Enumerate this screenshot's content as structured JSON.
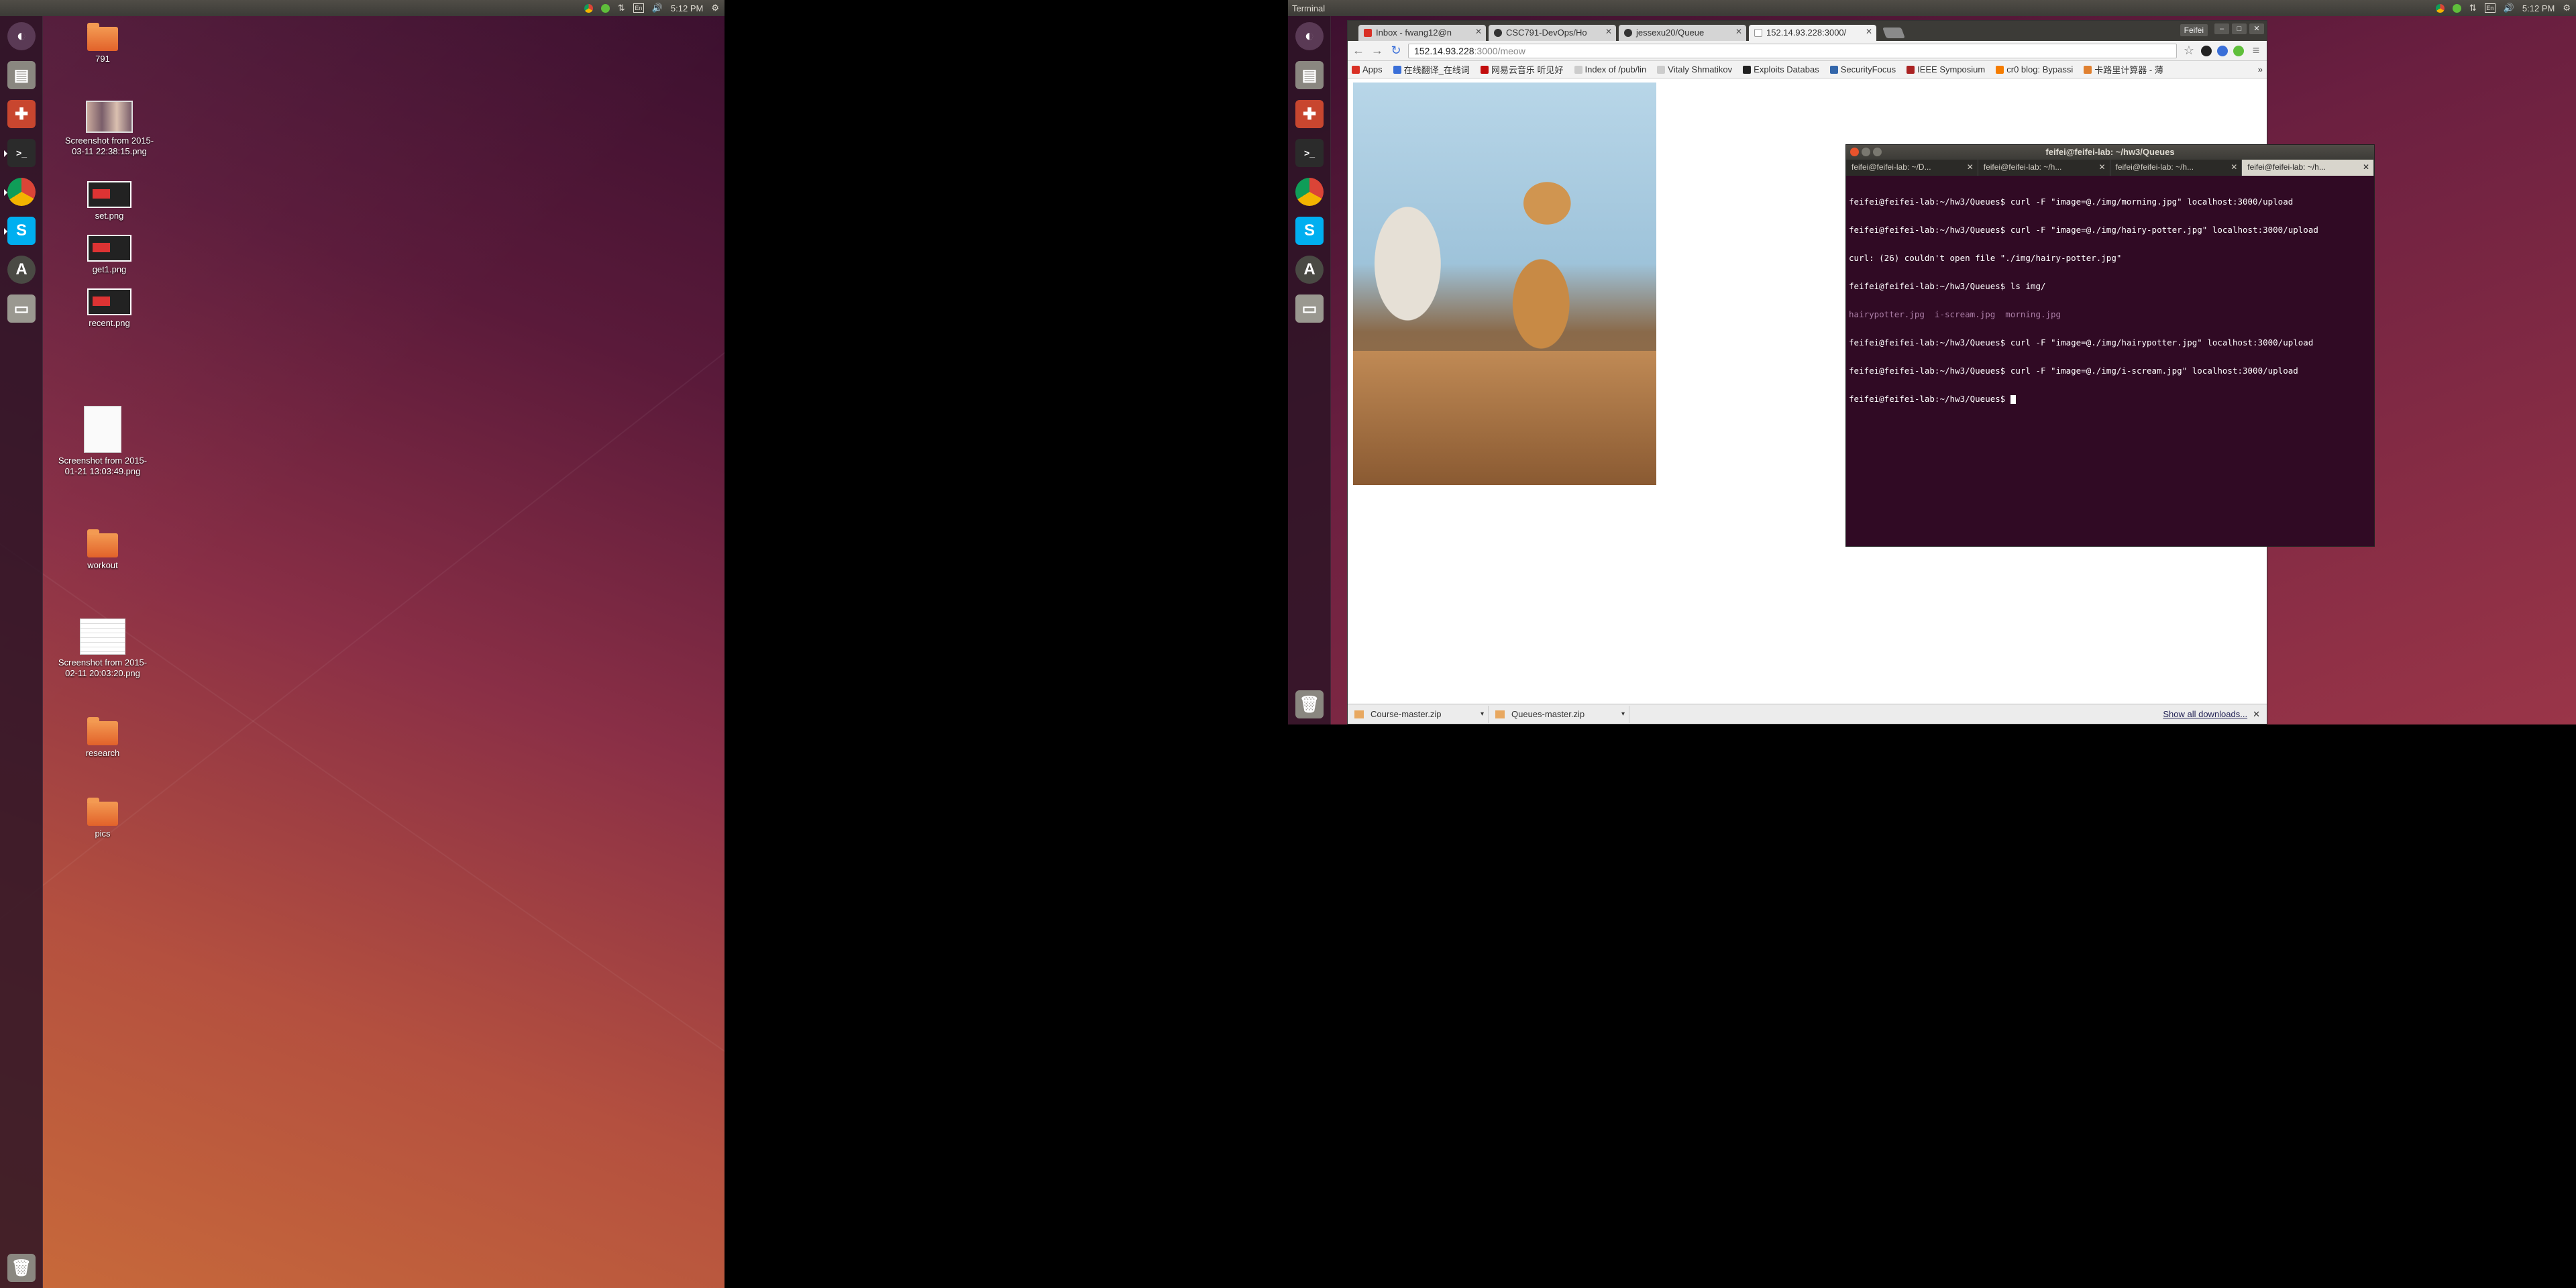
{
  "left_screen": {
    "panel": {
      "time": "5:12 PM",
      "keyboard": "En"
    },
    "launcher": [
      "dash-home",
      "files",
      "system-settings",
      "terminal",
      "chrome",
      "skype",
      "software-updater",
      "removable-drive",
      "trash"
    ],
    "desktop_icons": [
      {
        "type": "folder",
        "label": "791"
      },
      {
        "type": "photo",
        "label": "Screenshot from 2015-03-11 22:38:15.png"
      },
      {
        "type": "dark",
        "label": "set.png"
      },
      {
        "type": "dark",
        "label": "get1.png"
      },
      {
        "type": "dark",
        "label": "recent.png"
      },
      {
        "type": "doc",
        "label": "Screenshot from 2015-01-21 13:03:49.png"
      },
      {
        "type": "folder",
        "label": "workout"
      },
      {
        "type": "doc2",
        "label": "Screenshot from 2015-02-11 20:03:20.png"
      },
      {
        "type": "folder",
        "label": "research"
      },
      {
        "type": "folder",
        "label": "pics"
      }
    ]
  },
  "right_screen": {
    "panel": {
      "title": "Terminal",
      "time": "5:12 PM",
      "keyboard": "En"
    },
    "chrome": {
      "profile": "Feifei",
      "tabs": [
        {
          "label": "Inbox - fwang12@n",
          "favicon_color": "#d93025"
        },
        {
          "label": "CSC791-DevOps/Ho",
          "favicon_color": "#333333"
        },
        {
          "label": "jessexu20/Queue",
          "favicon_color": "#333333"
        },
        {
          "label": "152.14.93.228:3000/",
          "favicon_color": "#9a9a9a"
        }
      ],
      "url_host": "152.14.93.228",
      "url_path": ":3000/meow",
      "bookmarks": [
        {
          "label": "Apps",
          "color": "#d93025"
        },
        {
          "label": "在线翻译_在线词",
          "color": "#3a6fd8"
        },
        {
          "label": "网易云音乐 听见好",
          "color": "#c20c0c"
        },
        {
          "label": "Index of /pub/lin",
          "color": "#cccccc"
        },
        {
          "label": "Vitaly Shmatikov",
          "color": "#cccccc"
        },
        {
          "label": "Exploits Databas",
          "color": "#222222"
        },
        {
          "label": "SecurityFocus",
          "color": "#3366aa"
        },
        {
          "label": "IEEE Symposium",
          "color": "#aa2222"
        },
        {
          "label": "cr0 blog: Bypassi",
          "color": "#f57c00"
        },
        {
          "label": "卡路里计算器 - 薄",
          "color": "#e08030"
        }
      ],
      "downloads": [
        "Course-master.zip",
        "Queues-master.zip"
      ],
      "show_all": "Show all downloads..."
    },
    "terminal": {
      "title": "feifei@feifei-lab: ~/hw3/Queues",
      "tabs": [
        "feifei@feifei-lab: ~/D...",
        "feifei@feifei-lab: ~/h...",
        "feifei@feifei-lab: ~/h...",
        "feifei@feifei-lab: ~/h..."
      ],
      "lines": [
        {
          "text": "feifei@feifei-lab:~/hw3/Queues$ curl -F \"image=@./img/morning.jpg\" localhost:3000/upload",
          "style": ""
        },
        {
          "text": "feifei@feifei-lab:~/hw3/Queues$ curl -F \"image=@./img/hairy-potter.jpg\" localhost:3000/upload",
          "style": ""
        },
        {
          "text": "curl: (26) couldn't open file \"./img/hairy-potter.jpg\"",
          "style": ""
        },
        {
          "text": "feifei@feifei-lab:~/hw3/Queues$ ls img/",
          "style": ""
        },
        {
          "text": "hairypotter.jpg  i-scream.jpg  morning.jpg",
          "style": "dim"
        },
        {
          "text": "feifei@feifei-lab:~/hw3/Queues$ curl -F \"image=@./img/hairypotter.jpg\" localhost:3000/upload",
          "style": ""
        },
        {
          "text": "feifei@feifei-lab:~/hw3/Queues$ curl -F \"image=@./img/i-scream.jpg\" localhost:3000/upload",
          "style": ""
        },
        {
          "text": "feifei@feifei-lab:~/hw3/Queues$ ",
          "style": "cursor"
        }
      ]
    }
  }
}
